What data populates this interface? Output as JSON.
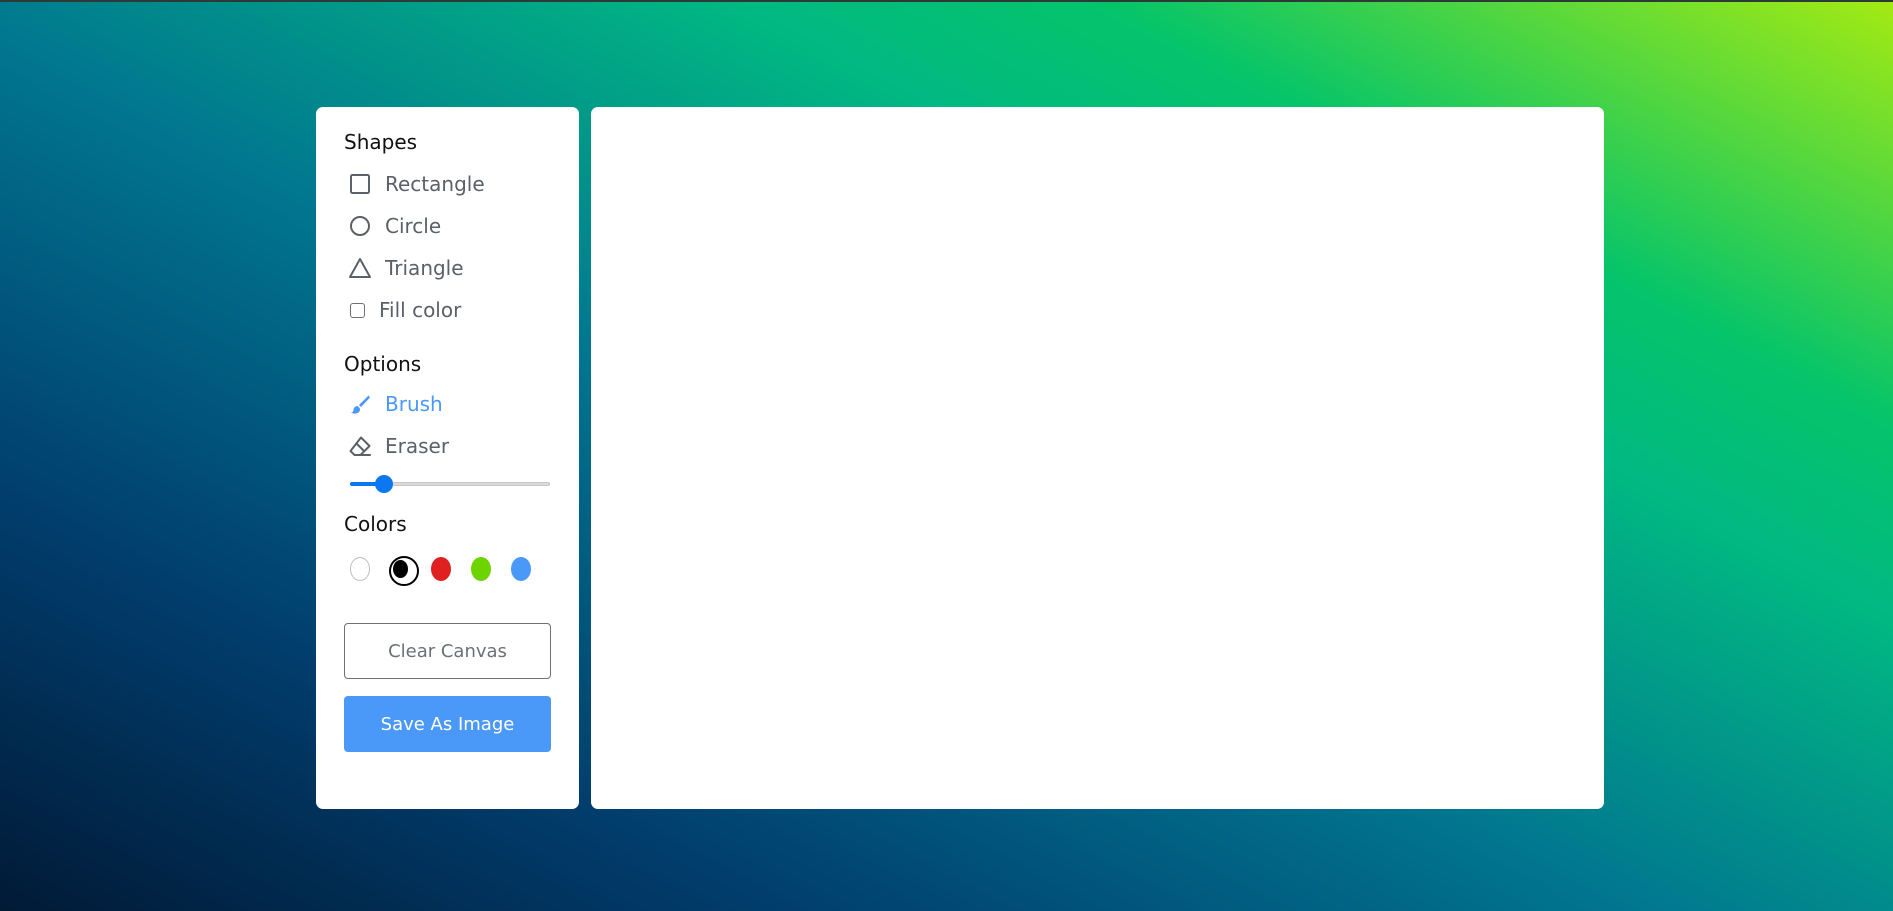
{
  "shapes": {
    "title": "Shapes",
    "items": [
      {
        "label": "Rectangle",
        "icon": "rectangle-icon"
      },
      {
        "label": "Circle",
        "icon": "circle-icon"
      },
      {
        "label": "Triangle",
        "icon": "triangle-icon"
      }
    ],
    "fill_label": "Fill color",
    "fill_checked": false
  },
  "options": {
    "title": "Options",
    "items": [
      {
        "label": "Brush",
        "icon": "brush-icon",
        "active": true
      },
      {
        "label": "Eraser",
        "icon": "eraser-icon",
        "active": false
      }
    ],
    "brush_size_fraction": 0.17
  },
  "colors": {
    "title": "Colors",
    "swatches": [
      "#ffffff",
      "#000000",
      "#e02020",
      "#6dd400",
      "#4a98f7"
    ],
    "selected_index": 1
  },
  "buttons": {
    "clear_label": "Clear Canvas",
    "save_label": "Save As Image"
  },
  "theme": {
    "accent": "#4a98f7",
    "slider": "#0b77f0",
    "muted_text": "#5a6168"
  }
}
